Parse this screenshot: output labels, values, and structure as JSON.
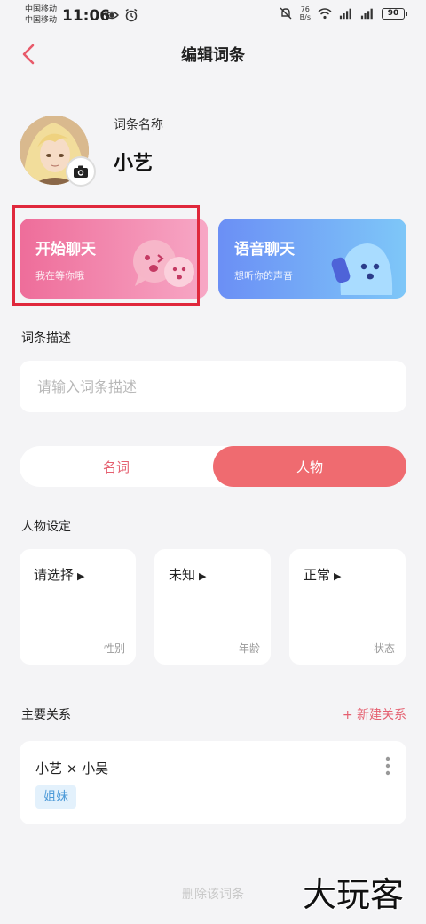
{
  "status_bar": {
    "carrier_1": "中国移动",
    "carrier_2": "中国移动",
    "time": "11:06",
    "net_speed_value": "76",
    "net_speed_unit": "B/s",
    "battery": "90"
  },
  "header": {
    "title": "编辑词条"
  },
  "entry": {
    "name_label": "词条名称",
    "name": "小艺"
  },
  "cards": {
    "start_chat": {
      "title": "开始聊天",
      "subtitle": "我在等你哦"
    },
    "voice_chat": {
      "title": "语音聊天",
      "subtitle": "想听你的声音"
    }
  },
  "description": {
    "label": "词条描述",
    "placeholder": "请输入词条描述",
    "value": ""
  },
  "segment": {
    "noun": "名词",
    "person": "人物",
    "selected": "人物"
  },
  "person_settings": {
    "label": "人物设定",
    "items": [
      {
        "value": "请选择",
        "label": "性别"
      },
      {
        "value": "未知",
        "label": "年龄"
      },
      {
        "value": "正常",
        "label": "状态"
      }
    ]
  },
  "relations": {
    "label": "主要关系",
    "new_button": "+ 新建关系",
    "items": [
      {
        "pair": "小艺 × 小吴",
        "tag": "姐妹"
      }
    ]
  },
  "delete_button": "删除该词条",
  "watermark": "大玩客",
  "colors": {
    "accent": "#ef6b70",
    "highlight_box": "#e0283c",
    "tag_bg": "#e3f1fc",
    "tag_text": "#4d9ad8"
  }
}
